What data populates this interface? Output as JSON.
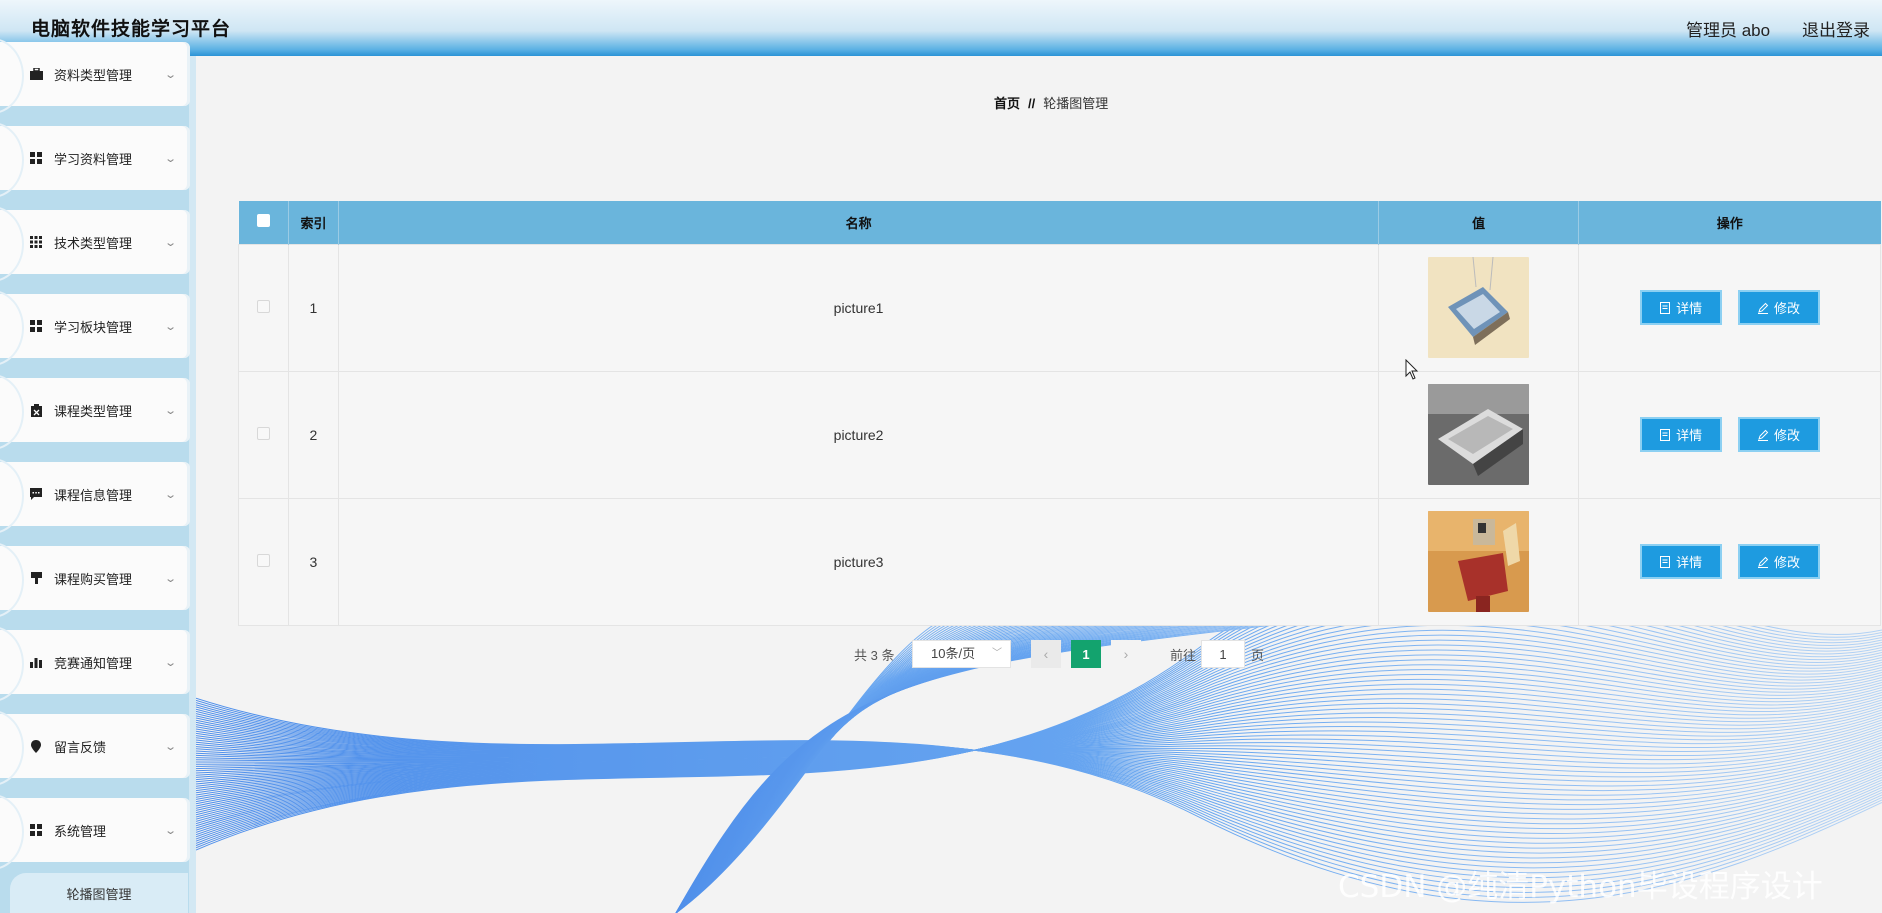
{
  "header": {
    "title": "电脑软件技能学习平台",
    "user": "管理员 abo",
    "logout": "退出登录"
  },
  "sidebar": {
    "items": [
      {
        "label": "资料类型管理",
        "icon": "briefcase-icon"
      },
      {
        "label": "学习资料管理",
        "icon": "grid-icon"
      },
      {
        "label": "技术类型管理",
        "icon": "apps-icon"
      },
      {
        "label": "学习板块管理",
        "icon": "grid-icon"
      },
      {
        "label": "课程类型管理",
        "icon": "clipboard-icon"
      },
      {
        "label": "课程信息管理",
        "icon": "comment-icon"
      },
      {
        "label": "课程购买管理",
        "icon": "flag-icon"
      },
      {
        "label": "竞赛通知管理",
        "icon": "bar-chart-icon"
      },
      {
        "label": "留言反馈",
        "icon": "location-pin-icon"
      },
      {
        "label": "系统管理",
        "icon": "grid-icon"
      }
    ],
    "active_sub": "轮播图管理"
  },
  "breadcrumb": {
    "home": "首页",
    "separator": "//",
    "current": "轮播图管理"
  },
  "table": {
    "headers": {
      "index": "索引",
      "name": "名称",
      "value": "值",
      "actions": "操作"
    },
    "rows": [
      {
        "index": "1",
        "name": "picture1"
      },
      {
        "index": "2",
        "name": "picture2"
      },
      {
        "index": "3",
        "name": "picture3"
      }
    ],
    "detail_label": "详情",
    "edit_label": "修改"
  },
  "pagination": {
    "total": "共 3 条",
    "page_size": "10条/页",
    "current_page": "1",
    "goto_label": "前往",
    "goto_value": "1",
    "goto_unit": "页"
  },
  "watermark": "CSDN @纯清Python毕设程序设计",
  "colors": {
    "header_blue": "#2a93d6",
    "table_header": "#6ab5dc",
    "button": "#1e9be0",
    "active_page": "#13a36e",
    "sidebar_bg": "#b9dced"
  }
}
